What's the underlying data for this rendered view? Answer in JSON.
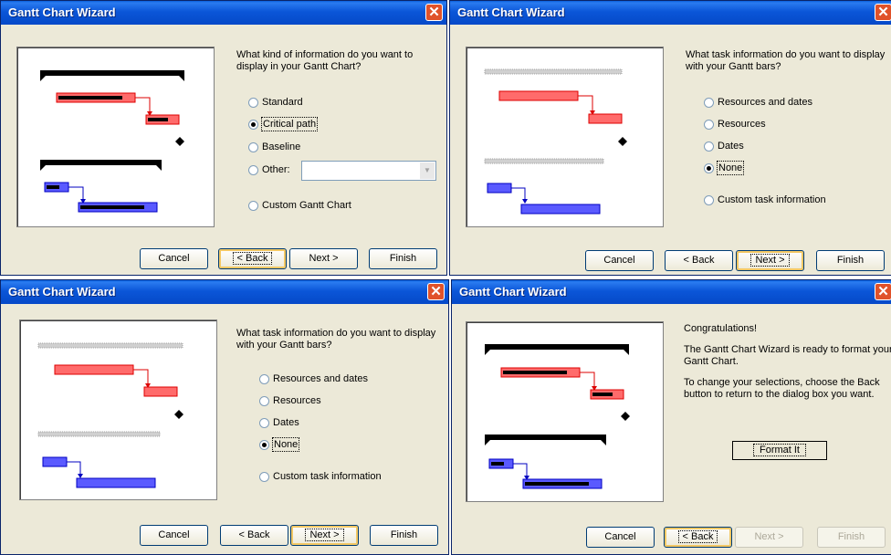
{
  "colors": {
    "titlebar": "#0a56d8",
    "dialog_bg": "#ece9d8",
    "close": "#e0522a",
    "critical_bar": "#ff6b6b",
    "task_bar": "#5a5aff",
    "summary_bar": "#000000"
  },
  "dialogs": [
    {
      "title": "Gantt Chart Wizard",
      "question": "What kind of information do you want to display in your Gantt Chart?",
      "options": [
        "Standard",
        "Critical path",
        "Baseline",
        "Other:",
        "Custom Gantt Chart"
      ],
      "selected": "Critical path",
      "other_value": "",
      "buttons": {
        "cancel": "Cancel",
        "back": "< Back",
        "next": "Next >",
        "finish": "Finish"
      }
    },
    {
      "title": "Gantt Chart Wizard",
      "question": "What task information do you want to display with your Gantt bars?",
      "options": [
        "Resources and dates",
        "Resources",
        "Dates",
        "None",
        "Custom task information"
      ],
      "selected": "None",
      "buttons": {
        "cancel": "Cancel",
        "back": "< Back",
        "next": "Next >",
        "finish": "Finish"
      }
    },
    {
      "title": "Gantt Chart Wizard",
      "question": "What task information do you want to display with your Gantt bars?",
      "options": [
        "Resources and dates",
        "Resources",
        "Dates",
        "None",
        "Custom task information"
      ],
      "selected": "None",
      "buttons": {
        "cancel": "Cancel",
        "back": "< Back",
        "next": "Next >",
        "finish": "Finish"
      }
    },
    {
      "title": "Gantt Chart Wizard",
      "congrats": "Congratulations!",
      "ready_text": "The Gantt Chart Wizard is ready to format your Gantt Chart.",
      "change_text": "To change your selections, choose the Back button to return to the dialog box you want.",
      "format_button": "Format It",
      "buttons": {
        "cancel": "Cancel",
        "back": "< Back",
        "next": "Next >",
        "finish": "Finish"
      }
    }
  ]
}
